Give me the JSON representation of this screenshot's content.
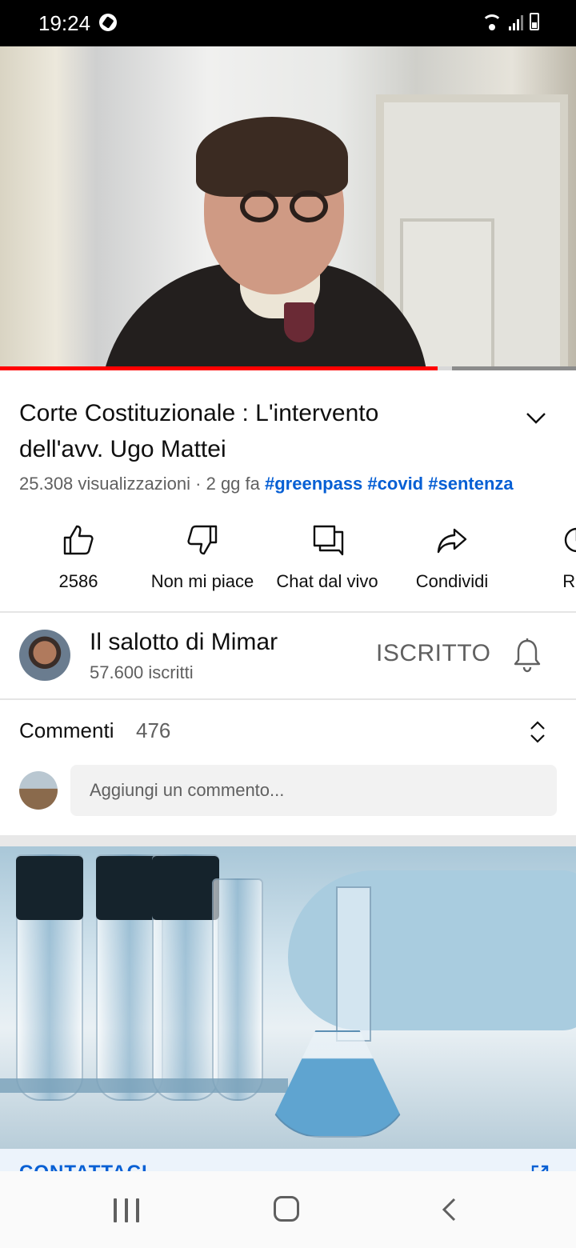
{
  "status_bar": {
    "time": "19:24"
  },
  "video": {
    "progress_played": 0.76,
    "progress_buffered": 0.785
  },
  "title": {
    "text": "Corte Costituzionale  : L'intervento dell'avv. Ugo Mattei"
  },
  "meta": {
    "views": "25.308 visualizzazioni",
    "separator": " · ",
    "age": "2 gg fa",
    "hashtags": [
      "#greenpass",
      "#covid",
      "#sentenza"
    ]
  },
  "actions": {
    "like": "2586",
    "dislike": "Non mi piace",
    "live_chat": "Chat dal vivo",
    "share": "Condividi",
    "remix_partial": "Rer"
  },
  "channel": {
    "name": "Il salotto di Mimar",
    "subscribers": "57.600 iscritti",
    "subscribe_state": "ISCRITTO"
  },
  "comments": {
    "label": "Commenti",
    "count": "476",
    "placeholder": "Aggiungi un commento..."
  },
  "ad": {
    "cta": "CONTATTACI"
  },
  "colors": {
    "accent_red": "#ff0000",
    "link_blue": "#065fd4",
    "secondary_text": "#606060"
  }
}
